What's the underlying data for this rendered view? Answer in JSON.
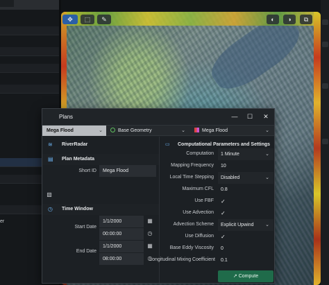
{
  "background": {
    "left_text_fragment": "er"
  },
  "map": {
    "tools": [
      "✥",
      "⬚",
      "✎",
      "◐",
      "◑",
      "⧉"
    ]
  },
  "dialog": {
    "title": "Plans",
    "window_buttons": {
      "minimize": "—",
      "maximize": "☐",
      "close": "✕"
    },
    "plan_select": "Mega Flood",
    "geometry_select": "Base Geometry",
    "flow_select": "Mega Flood",
    "left": {
      "riverradar_label": "RiverRadar",
      "plan_metadata_header": "Plan Metadata",
      "short_id_label": "Short ID",
      "short_id_value": "Mega Flood",
      "time_window_header": "Time Window",
      "start_date_label": "Start Date",
      "start_date_value": "1/1/2000",
      "start_time_value": "00:00:00",
      "end_date_label": "End Date",
      "end_date_value": "1/1/2000",
      "end_time_value": "08:00:00"
    },
    "right": {
      "header": "Computational Parameters and Settings",
      "rows": [
        {
          "label": "Computation",
          "value": "1 Minute",
          "dropdown": true
        },
        {
          "label": "Mapping Frequency",
          "value": "10",
          "dropdown": false
        },
        {
          "label": "Local Time Stepping",
          "value": "Disabled",
          "dropdown": true
        },
        {
          "label": "Maximum CFL",
          "value": "0.8",
          "dropdown": false
        },
        {
          "label": "Use FBF",
          "value": "✓",
          "dropdown": false
        },
        {
          "label": "Use Advection",
          "value": "✓",
          "dropdown": false
        },
        {
          "label": "Advection Scheme",
          "value": "Explicit Upwind",
          "dropdown": true
        },
        {
          "label": "Use Diffusion",
          "value": "✓",
          "dropdown": false
        },
        {
          "label": "Base Eddy Viscosity",
          "value": "0",
          "dropdown": false
        },
        {
          "label": "Longitudinal Mixing Coefficient",
          "value": "0.1",
          "dropdown": false
        }
      ]
    },
    "compute_label": "Compute"
  },
  "colors": {
    "accent": "#1f6b4a",
    "icon_blue": "#6ab0ee"
  }
}
